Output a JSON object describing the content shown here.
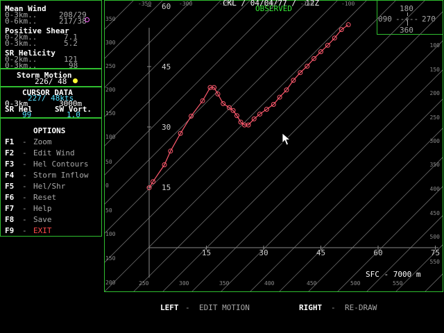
{
  "header": {
    "station_line": "CKL / 04/04/77 /  12Z",
    "mode": "OBSERVED"
  },
  "mean_wind": {
    "title": "Mean Wind",
    "rows": [
      {
        "label": "0-3km..",
        "value": "208/29"
      },
      {
        "label": "0-6km..",
        "value": "217/38"
      }
    ]
  },
  "positive_shear": {
    "title": "Positive Shear",
    "rows": [
      {
        "label": "0-2km..",
        "value": "7.1"
      },
      {
        "label": "0-3km..",
        "value": "5.2"
      }
    ]
  },
  "sr_helicity": {
    "title": "SR Helicity",
    "rows": [
      {
        "label": "0-2km..",
        "value": "121"
      },
      {
        "label": "0-3km..",
        "value": "98"
      }
    ]
  },
  "storm_motion": {
    "title": "Storm Motion",
    "value": "226/ 48"
  },
  "cursor_data": {
    "title": "CURSOR DATA",
    "wind": "227/ 48kts",
    "layer_label": "0-3km",
    "height": "3000m",
    "srhel_label": "SR Hel",
    "swvort_label": "SW Vort.",
    "srhel_value": "99",
    "swvort_value": "1.0"
  },
  "options": {
    "title": "OPTIONS",
    "items": [
      {
        "key": "F1",
        "label": "Zoom"
      },
      {
        "key": "F2",
        "label": "Edit Wind"
      },
      {
        "key": "F3",
        "label": "Hel Contours"
      },
      {
        "key": "F4",
        "label": "Storm Inflow"
      },
      {
        "key": "F5",
        "label": "Hel/Shr"
      },
      {
        "key": "F6",
        "label": "Reset"
      },
      {
        "key": "F7",
        "label": "Help"
      },
      {
        "key": "F8",
        "label": "Save"
      },
      {
        "key": "F9",
        "label": "EXIT"
      }
    ]
  },
  "compass": {
    "top": "180",
    "left": "090",
    "right": "270",
    "bottom": "360"
  },
  "hodograph": {
    "range_label": "SFC - 7000 m",
    "speed_ticks_x": [
      "15",
      "30",
      "45",
      "60",
      "75"
    ],
    "speed_ticks_y": [
      "60",
      "45",
      "30",
      "15"
    ],
    "helicity_labels_top": [
      "-350",
      "-300",
      "-250",
      "-200",
      "-150",
      "-100"
    ],
    "helicity_labels_left": [
      "350",
      "300",
      "250",
      "200",
      "150",
      "100",
      "50",
      "0",
      "50",
      "100",
      "150",
      "200"
    ],
    "helicity_labels_right": [
      "100",
      "150",
      "200",
      "250",
      "300",
      "350",
      "400",
      "450",
      "500",
      "550"
    ],
    "helicity_labels_bottom": [
      "250",
      "300",
      "350",
      "400",
      "450",
      "500",
      "550"
    ],
    "u_kts": [
      0,
      1,
      4,
      5.6,
      8.2,
      11,
      14,
      16,
      17,
      18,
      19.4,
      21,
      22,
      23,
      24,
      25,
      26,
      27.5,
      29,
      30.8,
      32.6,
      34.2,
      36,
      37.8,
      39.6,
      41.4,
      43.2,
      45,
      46.8,
      48.6,
      50.4,
      52.2
    ],
    "v_kts": [
      14.9,
      16.4,
      20.6,
      24,
      28.4,
      32.7,
      36.5,
      39.8,
      39.8,
      38.2,
      35.8,
      34.8,
      34.1,
      32.8,
      31.2,
      30.5,
      30.5,
      32.0,
      33.2,
      34.4,
      35.6,
      37.4,
      39.2,
      41.6,
      43.5,
      45.1,
      47.0,
      48.7,
      50.3,
      52.1,
      54.2,
      55.4
    ],
    "storm_motion_indicator_color": "#ffff33",
    "mean_wind_indicator_color": "#ff66ff"
  },
  "footer": {
    "left_key": "LEFT",
    "left_action": "EDIT MOTION",
    "right_key": "RIGHT",
    "right_action": "RE-DRAW"
  }
}
